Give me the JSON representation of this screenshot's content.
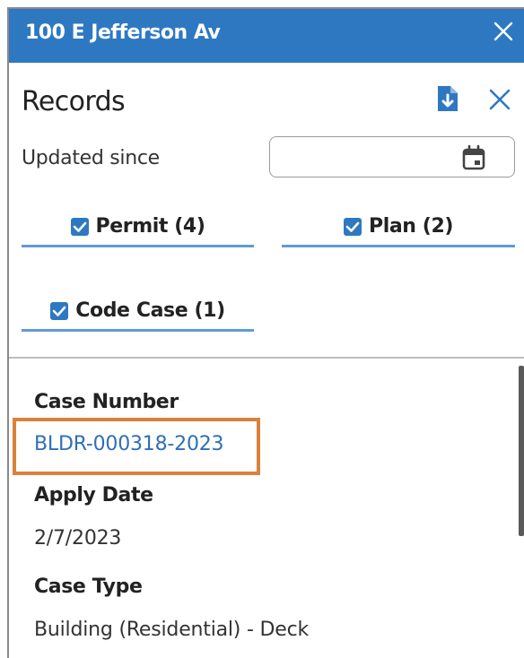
{
  "window": {
    "title": "100 E Jefferson Av",
    "close_icon": "close-icon"
  },
  "records": {
    "heading": "Records",
    "download_icon": "download-file-icon",
    "close_icon": "close-icon",
    "updated_since_label": "Updated since",
    "date_value": "",
    "calendar_icon": "calendar-icon"
  },
  "filters": [
    {
      "label": "Permit (4)",
      "checked": true
    },
    {
      "label": "Plan (2)",
      "checked": true
    },
    {
      "label": "Code Case (1)",
      "checked": true
    }
  ],
  "fields": {
    "case_number": {
      "label": "Case Number",
      "value": "BLDR-000318-2023"
    },
    "apply_date": {
      "label": "Apply Date",
      "value": "2/7/2023"
    },
    "case_type": {
      "label": "Case Type",
      "value": "Building (Residential) - Deck"
    }
  },
  "colors": {
    "title_bar": "#2e78c2",
    "link": "#2f6fb5",
    "highlight": "#d9823b",
    "checkbox": "#2e78c2"
  }
}
